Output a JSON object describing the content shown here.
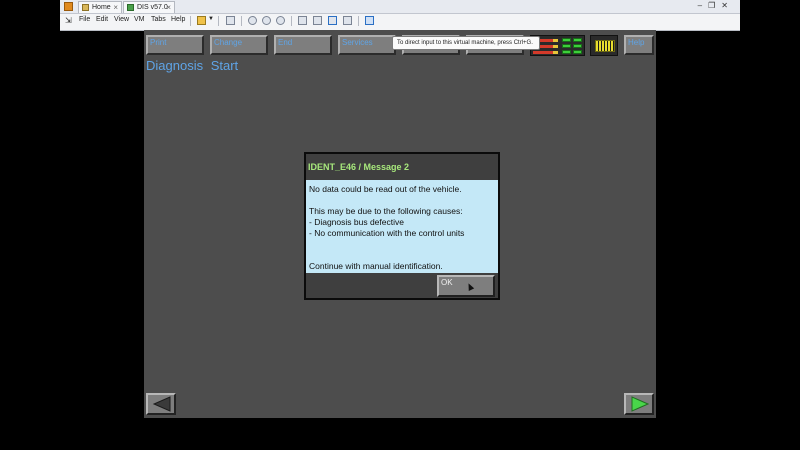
{
  "chrome": {
    "tabs": [
      {
        "label": "Home",
        "icon": "home-icon"
      },
      {
        "label": "DIS v57.0",
        "icon": "vm-icon"
      }
    ],
    "menu": [
      "File",
      "Edit",
      "View",
      "VM",
      "Tabs",
      "Help"
    ],
    "window_controls": [
      "minimize-icon",
      "restore-icon",
      "close-icon"
    ]
  },
  "vm_tooltip": "To direct input to this virtual machine, press Ctrl+G.",
  "toolbar": {
    "print": "Print",
    "change": "Change",
    "end": "End",
    "services": "Services",
    "help": "Help"
  },
  "page": {
    "title": "Diagnosis  Start"
  },
  "dialog": {
    "title": "IDENT_E46 / Message 2",
    "line1": "No data could be read out of the vehicle.",
    "line2": "This may be due to the following causes:",
    "line3": "- Diagnosis bus defective",
    "line4": "- No communication with the control units",
    "line5": "Continue with manual identification.",
    "ok": "OK"
  },
  "status": {
    "bus_connection": "green",
    "battery": "yellow"
  },
  "colors": {
    "screen_bg": "#4d4d4d",
    "button_text": "#5fa4e6",
    "dialog_title": "#a7e87c",
    "dialog_body": "#c4e8f7"
  },
  "nav": {
    "back": "arrow-left-icon",
    "forward": "arrow-right-icon"
  }
}
